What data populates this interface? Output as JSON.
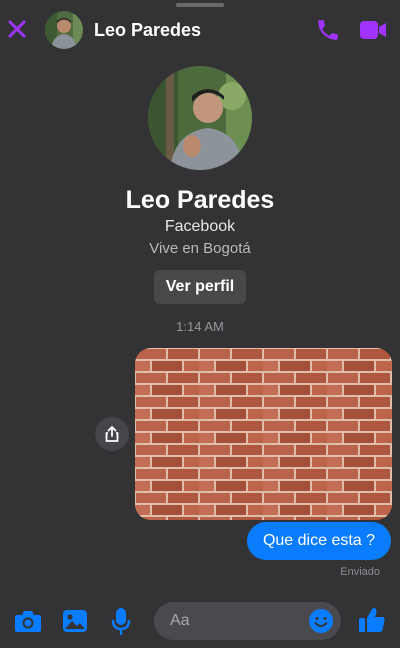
{
  "header": {
    "contact_name": "Leo Paredes"
  },
  "profile": {
    "name": "Leo Paredes",
    "source": "Facebook",
    "location": "Vive en Bogotá",
    "view_profile_label": "Ver perfil"
  },
  "conversation": {
    "timestamp": "1:14 AM",
    "messages": [
      {
        "type": "image",
        "content": "brick-wall-photo"
      },
      {
        "type": "text",
        "text": "Que dice esta ?"
      }
    ],
    "status": "Enviado"
  },
  "composer": {
    "placeholder": "Aa"
  },
  "icons": {
    "close": "close-icon",
    "call": "phone-icon",
    "video": "video-camera-icon",
    "share": "share-icon",
    "camera": "camera-icon",
    "gallery": "gallery-icon",
    "mic": "microphone-icon",
    "emoji": "emoji-icon",
    "like": "thumbs-up-icon"
  },
  "colors": {
    "background": "#333335",
    "accent_purple": "#a033ff",
    "messenger_blue": "#0a7cff",
    "bubble_text": "#ffffff"
  }
}
